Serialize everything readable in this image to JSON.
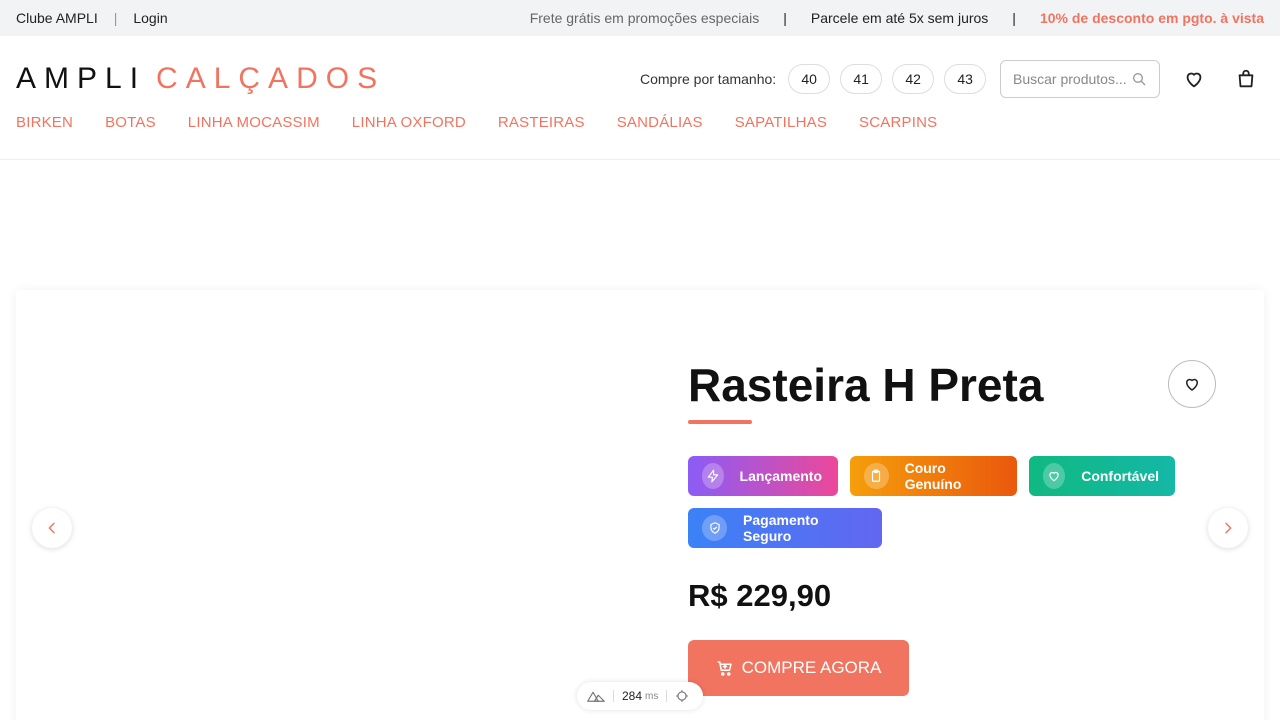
{
  "topbar": {
    "club": "Clube AMPLI",
    "separator": "|",
    "login": "Login",
    "promos": [
      "Frete grátis em promoções especiais",
      "Parcele em até 5x sem juros",
      "10% de desconto em pgto. à vista"
    ],
    "divider": "|"
  },
  "header": {
    "logo_part1": "AMPLI",
    "logo_part2": "CALÇADOS",
    "sizes_label": "Compre por tamanho:",
    "sizes": [
      "40",
      "41",
      "42",
      "43"
    ],
    "search_placeholder": "Buscar produtos...",
    "icons": [
      "search-icon",
      "heart-icon",
      "shopping-bag-icon"
    ]
  },
  "nav": {
    "items": [
      "BIRKEN",
      "BOTAS",
      "LINHA MOCASSIM",
      "LINHA OXFORD",
      "RASTEIRAS",
      "SANDÁLIAS",
      "SAPATILHAS",
      "SCARPINS"
    ]
  },
  "product": {
    "title": "Rasteira H Preta",
    "badges": [
      {
        "label": "Lançamento",
        "icon": "lightning-icon"
      },
      {
        "label": "Couro Genuíno",
        "icon": "clipboard-icon"
      },
      {
        "label": "Confortável",
        "icon": "heart-icon"
      },
      {
        "label": "Pagamento Seguro",
        "icon": "shield-icon"
      }
    ],
    "price": "R$ 229,90",
    "buy_label": "COMPRE AGORA"
  },
  "devbar": {
    "time": "284",
    "unit": "ms"
  },
  "colors": {
    "accent": "#f07460",
    "text": "#111111"
  }
}
